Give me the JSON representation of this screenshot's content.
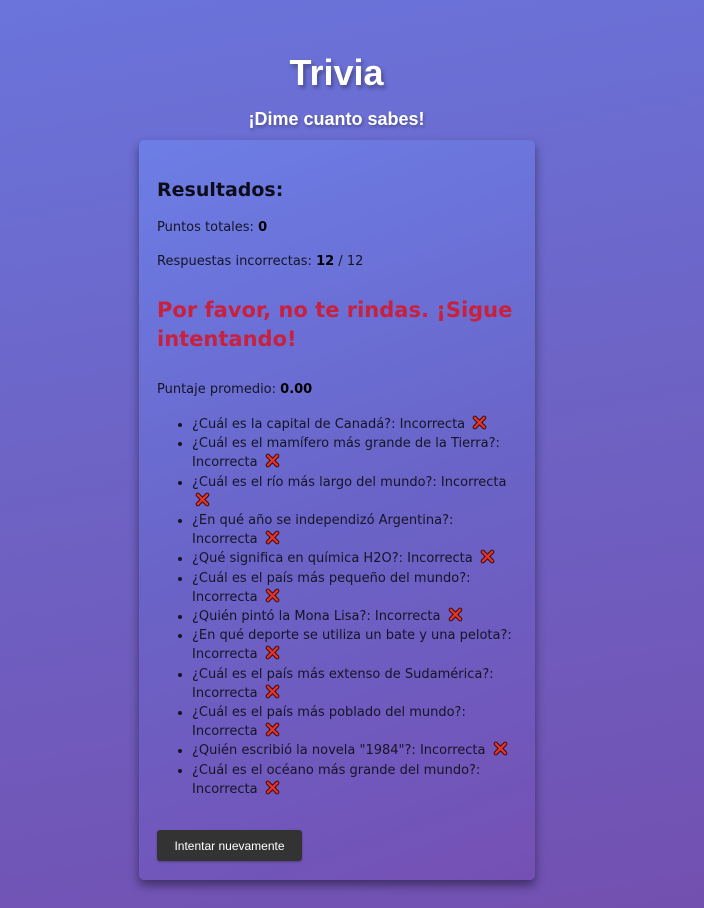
{
  "header": {
    "title": "Trivia",
    "subtitle": "¡Dime cuanto sabes!"
  },
  "results": {
    "heading": "Resultados:",
    "points_label": "Puntos totales: ",
    "points_value": "0",
    "incorrect_label": "Respuestas incorrectas: ",
    "incorrect_value": "12",
    "incorrect_total": " / 12",
    "message": "Por favor, no te rindas. ¡Sigue intentando!",
    "message_color": "#c8213e",
    "average_label": "Puntaje promedio: ",
    "average_value": "0.00",
    "answers": [
      {
        "text": "¿Cuál es la capital de Canadá?: Incorrecta",
        "icon": "cross-mark-icon"
      },
      {
        "text": "¿Cuál es el mamífero más grande de la Tierra?: Incorrecta",
        "icon": "cross-mark-icon"
      },
      {
        "text": "¿Cuál es el río más largo del mundo?: Incorrecta",
        "icon": "cross-mark-icon"
      },
      {
        "text": "¿En qué año se independizó Argentina?: Incorrecta",
        "icon": "cross-mark-icon"
      },
      {
        "text": "¿Qué significa en química H2O?: Incorrecta",
        "icon": "cross-mark-icon"
      },
      {
        "text": "¿Cuál es el país más pequeño del mundo?: Incorrecta",
        "icon": "cross-mark-icon"
      },
      {
        "text": "¿Quién pintó la Mona Lisa?: Incorrecta",
        "icon": "cross-mark-icon"
      },
      {
        "text": "¿En qué deporte se utiliza un bate y una pelota?: Incorrecta",
        "icon": "cross-mark-icon"
      },
      {
        "text": "¿Cuál es el país más extenso de Sudamérica?: Incorrecta",
        "icon": "cross-mark-icon"
      },
      {
        "text": "¿Cuál es el país más poblado del mundo?: Incorrecta",
        "icon": "cross-mark-icon"
      },
      {
        "text": "¿Quién escribió la novela \"1984\"?: Incorrecta",
        "icon": "cross-mark-icon"
      },
      {
        "text": "¿Cuál es el océano más grande del mundo?: Incorrecta",
        "icon": "cross-mark-icon"
      }
    ],
    "retry_label": "Intentar nuevamente",
    "retry_color": "#333333"
  }
}
